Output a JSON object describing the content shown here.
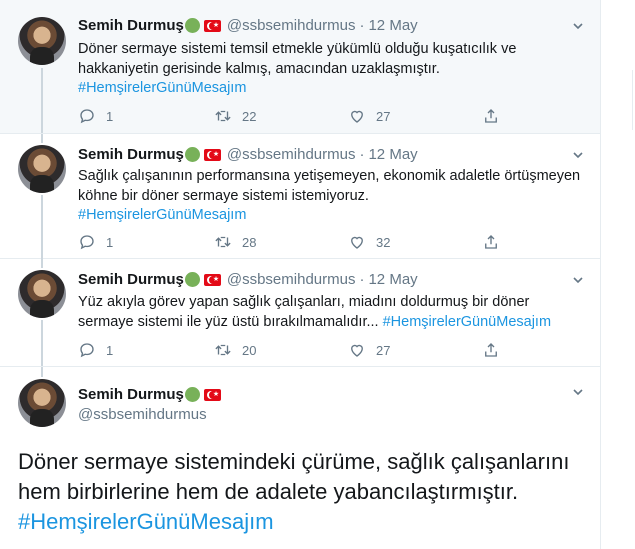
{
  "tweets": [
    {
      "name": "Semih Durmuş",
      "handle": "@ssbsemihdurmus",
      "sep": "·",
      "date": "12 May",
      "text": "Döner sermaye sistemi temsil etmekle yükümlü olduğu kuşatıcılık ve hakkaniyetin gerisinde kalmış, amacından uzaklaşmıştır.",
      "hashtag": "#HemşirelerGünüMesajım",
      "replies": "1",
      "retweets": "22",
      "likes": "27"
    },
    {
      "name": "Semih Durmuş",
      "handle": "@ssbsemihdurmus",
      "sep": "·",
      "date": "12 May",
      "text": "Sağlık çalışanının performansına yetişemeyen, ekonomik adaletle örtüşmeyen köhne bir döner sermaye sistemi istemiyoruz.",
      "hashtag": "#HemşirelerGünüMesajım",
      "replies": "1",
      "retweets": "28",
      "likes": "32"
    },
    {
      "name": "Semih Durmuş",
      "handle": "@ssbsemihdurmus",
      "sep": "·",
      "date": "12 May",
      "text": "Yüz akıyla görev yapan sağlık çalışanları, miadını doldurmuş bir döner sermaye sistemi ile yüz üstü bırakılmamalıdır...",
      "hashtag": "#HemşirelerGünüMesajım",
      "replies": "1",
      "retweets": "20",
      "likes": "27"
    }
  ],
  "main_tweet": {
    "name": "Semih Durmuş",
    "handle": "@ssbsemihdurmus",
    "text_line1": "Döner sermaye sistemindeki çürüme, sağlık çalışanlarını",
    "text_line2": "hem birbirlerine hem de adalete yabancılaştırmıştır.",
    "hashtag": "#HemşirelerGünüMesajım"
  },
  "colors": {
    "accent": "#1b95e0",
    "muted": "#657786",
    "highlight_bg": "#f5f8fa",
    "flag_red": "#e30a17",
    "green_dot": "#78b159"
  },
  "icons": [
    "reply-icon",
    "retweet-icon",
    "like-icon",
    "share-icon",
    "chevron-down-icon",
    "green-circle-emoji",
    "turkey-flag-emoji"
  ]
}
